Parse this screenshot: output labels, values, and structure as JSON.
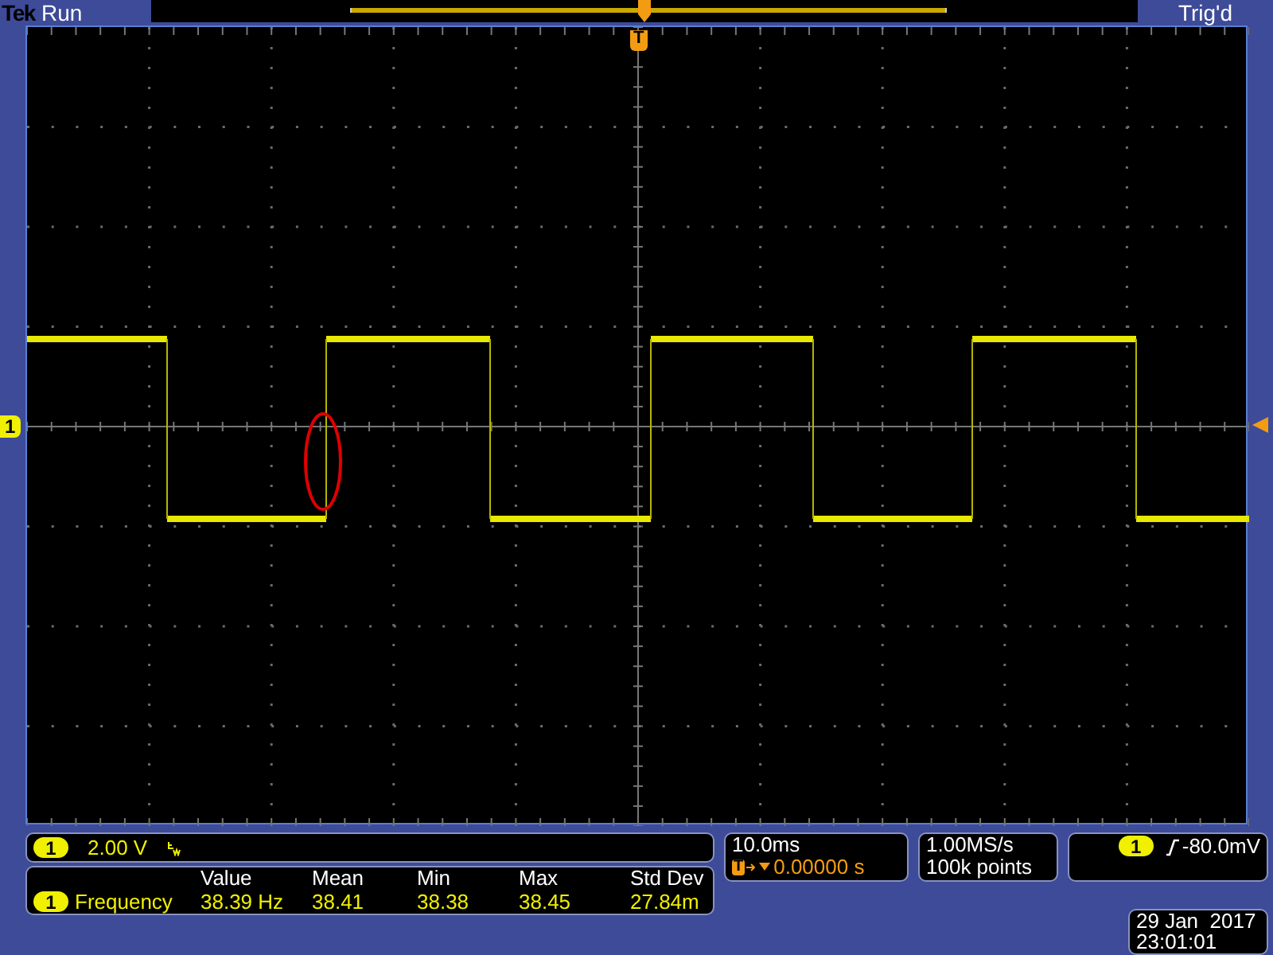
{
  "header": {
    "brand": "Tek",
    "state": "Run",
    "trigger_status": "Trig'd"
  },
  "display": {
    "channel_marker": "1",
    "trigger_marker": "T"
  },
  "channel": {
    "number": "1",
    "scale": "2.00 V"
  },
  "measurement": {
    "columns": [
      "Value",
      "Mean",
      "Min",
      "Max",
      "Std Dev"
    ],
    "rows": [
      {
        "channel": "1",
        "name": "Frequency",
        "cells": [
          "38.39 Hz",
          "38.41",
          "38.38",
          "38.45",
          "27.84m"
        ]
      }
    ]
  },
  "timebase": {
    "scale": "10.0ms",
    "marker": "T",
    "delay": "0.00000 s"
  },
  "acquisition": {
    "sample_rate": "1.00MS/s",
    "record_length": "100k points"
  },
  "trigger": {
    "channel": "1",
    "level": "-80.0mV"
  },
  "date": {
    "date": "29 Jan  2017",
    "time": "23:01:01"
  }
}
